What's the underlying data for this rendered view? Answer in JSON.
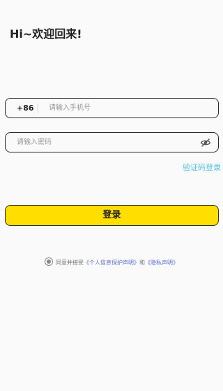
{
  "greeting": "Hi~欢迎回来!",
  "phone_field": {
    "country_code": "+86",
    "placeholder": "请输入手机号",
    "value": ""
  },
  "password_field": {
    "placeholder": "请输入密码",
    "value": "",
    "toggle_icon": "eye-off-icon"
  },
  "code_login_link": "验证码登录",
  "login_button": "登录",
  "agreement": {
    "prefix": "同意并接受",
    "privacy_link": "《个人信息保护声明》",
    "and": "和",
    "policy_link": "《隐私声明》"
  },
  "colors": {
    "accent": "#ffde00",
    "link": "#4fc0e0",
    "agreement_link": "#5a6fd6"
  }
}
